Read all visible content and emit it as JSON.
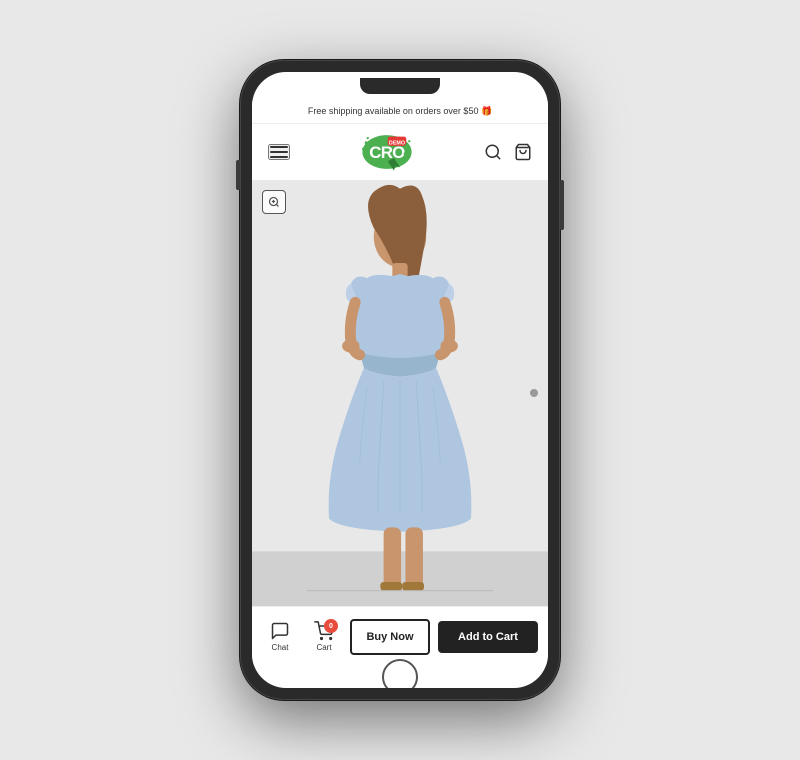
{
  "phone": {
    "announcement": {
      "text": "Free shipping available on orders over $50 🎁"
    },
    "header": {
      "logo_alt": "CRO Demo",
      "search_label": "search",
      "cart_label": "cart"
    },
    "product": {
      "image_alt": "Light blue ruffle dress worn by a woman",
      "zoom_label": "zoom"
    },
    "bottom_bar": {
      "chat_label": "Chat",
      "cart_label": "Cart",
      "cart_badge": "0",
      "buy_now_label": "Buy Now",
      "add_to_cart_label": "Add to Cart"
    }
  }
}
